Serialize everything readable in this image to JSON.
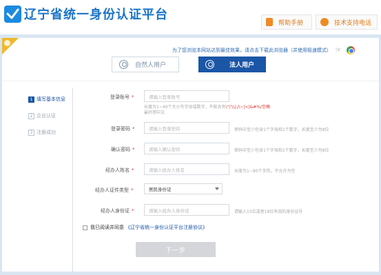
{
  "header": {
    "title": "辽宁省统一身份认证平台",
    "help_label": "帮助手册",
    "phone_label": "技术支持电话"
  },
  "browser_tip": "为了您浏览本网站达到最佳效果，请点击下载此浏览器（并使用极速模式）",
  "tabs": [
    {
      "label": "自然人用户",
      "active": false
    },
    {
      "label": "法人用户",
      "active": true
    }
  ],
  "steps": [
    {
      "num": "1",
      "label": "填写基本信息",
      "active": true
    },
    {
      "num": "2",
      "label": "企业认证",
      "active": false
    },
    {
      "num": "3",
      "label": "注册成功",
      "active": false
    }
  ],
  "form": {
    "account": {
      "label": "登录账号",
      "required": "*",
      "placeholder": "请输入登录账号",
      "hint_line1_prefix": "长度为1~40个大小写字母或数字，不能含有",
      "hint_line1_red": "\\“|'\\\\|;/\\~|<|&#%/空格",
      "hint_line2": "",
      "hint_line2b": "最好用中文"
    },
    "password": {
      "label": "登录密码",
      "required": "*",
      "placeholder": "请输入登录密码",
      "hint": "密码中至少包含1个字母和1个数字，长度至少为8位"
    },
    "confirm": {
      "label": "确认密码",
      "required": "*",
      "placeholder": "请输入确认密码",
      "hint": "密码中至少包含1个字母和1个数字，长度至少为8位"
    },
    "agent_name": {
      "label": "经办人姓名",
      "required": "*",
      "placeholder": "请输入经办人姓名",
      "hint": "长度为1~80个字符，不允许为空"
    },
    "id_type": {
      "label": "经办人证件类型",
      "required": "*",
      "value": "居民身份证"
    },
    "id_number": {
      "label": "经办人身份证",
      "required": "*",
      "placeholder": "请输入经办人身份证",
      "hint": "请输入15位或者18位有效的身份证号"
    }
  },
  "agree": {
    "text": "我已阅读并同意",
    "link": "《辽宁省统一身份认证平台注册协议》"
  },
  "next_button": "下一步",
  "colors": {
    "brand": "#1b56a6",
    "title_blue": "#1a73c9",
    "orange": "#e07b16",
    "required_red": "#e0312b"
  }
}
